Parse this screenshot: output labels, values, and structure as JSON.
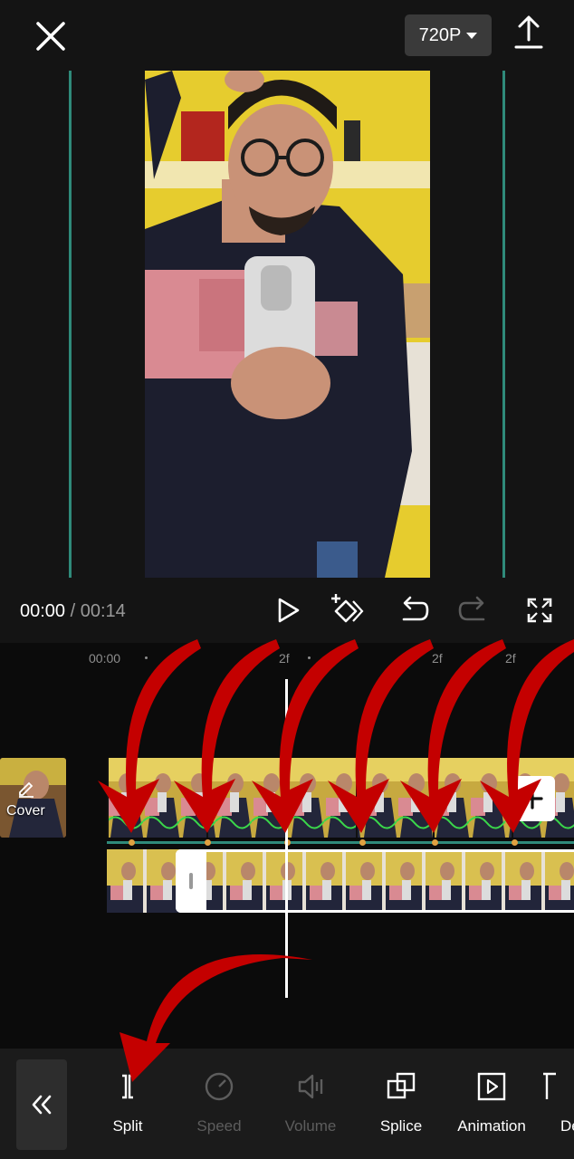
{
  "topbar": {
    "resolution_label": "720P",
    "close_icon": "close-icon",
    "export_icon": "export-upload-icon"
  },
  "playback": {
    "current_time": "00:00",
    "separator": "/",
    "total_time": "00:14",
    "icons": [
      "play-icon",
      "keyframe-icon",
      "undo-icon",
      "redo-icon",
      "fullscreen-icon"
    ]
  },
  "timeline": {
    "ruler_start": "00:00",
    "ruler_partial_labels": [
      "2f",
      "2f",
      "2f"
    ],
    "cover_label": "Cover",
    "cover_icon": "edit-pencil-icon",
    "add_clip_icon": "plus-icon"
  },
  "toolbar": {
    "back_icon": "double-chevron-left-icon",
    "tools": [
      {
        "label": "Split",
        "icon": "split-icon",
        "enabled": true
      },
      {
        "label": "Speed",
        "icon": "speed-icon",
        "enabled": false
      },
      {
        "label": "Volume",
        "icon": "volume-icon",
        "enabled": false
      },
      {
        "label": "Splice",
        "icon": "splice-icon",
        "enabled": true
      },
      {
        "label": "Animation",
        "icon": "animation-icon",
        "enabled": true
      },
      {
        "label": "De",
        "icon": "delete-icon",
        "enabled": true
      }
    ]
  },
  "colors": {
    "accent_teal": "#2f8a7a",
    "annotation_red": "#c40000",
    "background": "#111111",
    "disabled_text": "#5d5d5d"
  }
}
